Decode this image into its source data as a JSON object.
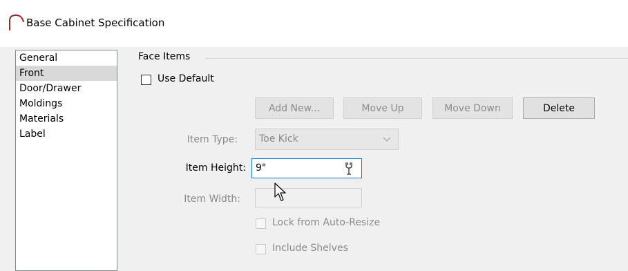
{
  "window": {
    "title": "Base Cabinet Specification",
    "icon": "arch-icon"
  },
  "nav": {
    "items": [
      {
        "label": "General",
        "selected": false
      },
      {
        "label": "Front",
        "selected": true
      },
      {
        "label": "Door/Drawer",
        "selected": false
      },
      {
        "label": "Moldings",
        "selected": false
      },
      {
        "label": "Materials",
        "selected": false
      },
      {
        "label": "Label",
        "selected": false
      }
    ]
  },
  "face_items": {
    "group_title": "Face Items",
    "use_default_label": "Use Default",
    "use_default_checked": false,
    "buttons": {
      "add_new": "Add New...",
      "move_up": "Move Up",
      "move_down": "Move Down",
      "delete": "Delete"
    },
    "item_type": {
      "label": "Item Type:",
      "value": "Toe Kick"
    },
    "item_height": {
      "label": "Item Height:",
      "value": "9\""
    },
    "item_width": {
      "label": "Item Width:",
      "value": ""
    },
    "lock_auto_resize": {
      "label": "Lock from Auto-Resize",
      "checked": false
    },
    "include_shelves": {
      "label": "Include Shelves",
      "checked": false
    }
  },
  "colors": {
    "focus_border": "#0078d7",
    "selected_nav": "#d9d9d9",
    "disabled_text": "#8a8a8a"
  }
}
